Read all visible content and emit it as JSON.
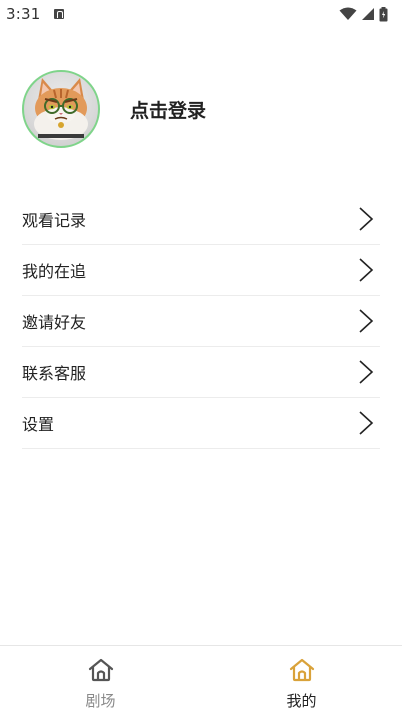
{
  "status_bar": {
    "time": "3:31",
    "icons": [
      "notification-icon",
      "wifi-icon",
      "signal-icon",
      "battery-icon"
    ]
  },
  "profile": {
    "avatar": "cat-avatar",
    "login_label": "点击登录"
  },
  "menu": {
    "items": [
      {
        "label": "观看记录",
        "icon": "chevron-right-icon"
      },
      {
        "label": "我的在追",
        "icon": "chevron-right-icon"
      },
      {
        "label": "邀请好友",
        "icon": "chevron-right-icon"
      },
      {
        "label": "联系客服",
        "icon": "chevron-right-icon"
      },
      {
        "label": "设置",
        "icon": "chevron-right-icon"
      }
    ]
  },
  "tabbar": {
    "tabs": [
      {
        "label": "剧场",
        "icon": "home-icon",
        "active": false
      },
      {
        "label": "我的",
        "icon": "home-icon",
        "active": true
      }
    ],
    "active_color": "#d9a23a",
    "inactive_color": "#555555"
  }
}
